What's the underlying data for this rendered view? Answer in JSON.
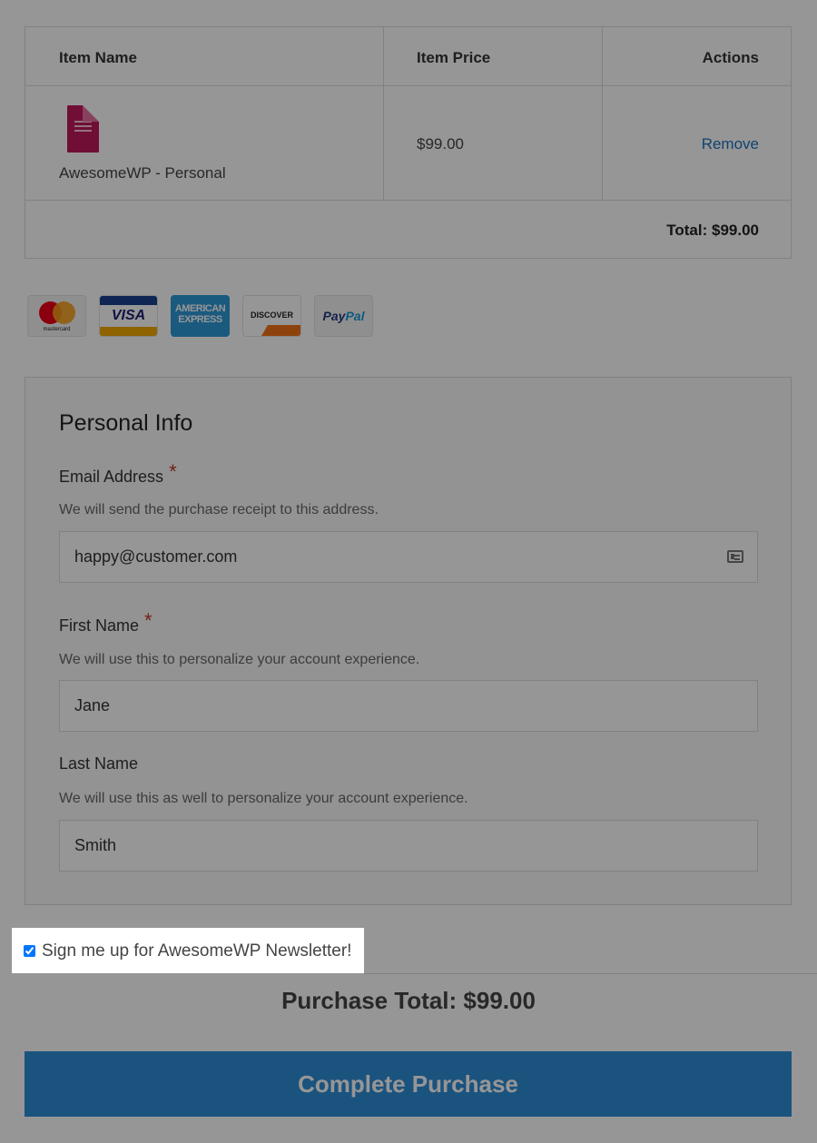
{
  "cart": {
    "headers": {
      "name": "Item Name",
      "price": "Item Price",
      "actions": "Actions"
    },
    "items": [
      {
        "name": "AwesomeWP - Personal",
        "price": "$99.00",
        "action": "Remove",
        "thumbnail": "product-cover-image"
      }
    ],
    "total": "Total: $99.00"
  },
  "payment_methods": [
    {
      "name": "mastercard",
      "label": "mastercard"
    },
    {
      "name": "visa",
      "label": "VISA"
    },
    {
      "name": "american-express",
      "label": "AMERICAN EXPRESS"
    },
    {
      "name": "discover",
      "label": "DISCOVER"
    },
    {
      "name": "paypal",
      "label_a": "Pay",
      "label_b": "Pal"
    }
  ],
  "personal_info": {
    "legend": "Personal Info",
    "required_marker": "*",
    "email": {
      "label": "Email Address",
      "description": "We will send the purchase receipt to this address.",
      "value": "happy@customer.com",
      "icon": "contact-card-icon"
    },
    "first_name": {
      "label": "First Name",
      "description": "We will use this to personalize your account experience.",
      "value": "Jane"
    },
    "last_name": {
      "label": "Last Name",
      "description": "We will use this as well to personalize your account experience.",
      "value": "Smith"
    }
  },
  "newsletter": {
    "label": "Sign me up for AwesomeWP Newsletter!",
    "checked": true
  },
  "purchase_total": "Purchase Total: $99.00",
  "submit_label": "Complete Purchase",
  "colors": {
    "accent": "#2e8ed9",
    "link": "#1e73be",
    "required": "#c0392b",
    "product": "#c1185a"
  }
}
